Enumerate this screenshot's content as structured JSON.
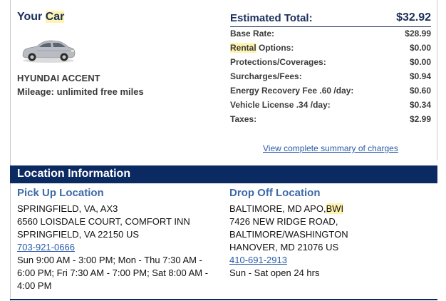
{
  "car": {
    "heading_plain": "Your ",
    "heading_highlight": "Car",
    "model": "HYUNDAI ACCENT",
    "mileage": "Mileage: unlimited free miles",
    "color": "#b9bcc2"
  },
  "estimate": {
    "title": "Estimated Total:",
    "total": "$32.92",
    "charges": [
      {
        "label": "Base Rate:",
        "amount": "$28.99"
      },
      {
        "label_highlight": "Rental",
        "label_rest": " Options:",
        "amount": "$0.00"
      },
      {
        "label": "Protections/Coverages:",
        "amount": "$0.00"
      },
      {
        "label": "Surcharges/Fees:",
        "amount": "$0.94"
      },
      {
        "label": "Energy Recovery Fee .60 /day:",
        "amount": "$0.60"
      },
      {
        "label": "Vehicle License .34 /day:",
        "amount": "$0.34"
      },
      {
        "label": "Taxes:",
        "amount": "$2.99"
      }
    ],
    "summary_link": "View complete summary of charges"
  },
  "location": {
    "section_title": "Location Information",
    "pickup": {
      "heading": "Pick Up Location",
      "line1": "SPRINGFIELD, VA, AX3",
      "line2": "6560 LOISDALE COURT, COMFORT INN",
      "line3": "SPRINGFIELD, VA 22150 US",
      "phone": "703-921-0666",
      "hours": "Sun 9:00 AM - 3:00 PM; Mon - Thu 7:30 AM - 6:00 PM; Fri 7:30 AM - 7:00 PM; Sat 8:00 AM - 4:00 PM"
    },
    "dropoff": {
      "heading": "Drop Off Location",
      "line1_plain": "BALTIMORE, MD APO,",
      "line1_highlight": "BWI",
      "line2": "7426 NEW RIDGE ROAD,",
      "line3": "BALTIMORE/WASHINGTON",
      "line4": "HANOVER, MD 21076 US",
      "phone": "410-691-2913",
      "hours": "Sun - Sat open 24 hrs"
    }
  },
  "colors": {
    "navy": "#0b2a62",
    "heading_blue": "#1b2f5c",
    "link_blue": "#2a5aa8",
    "highlight": "#fff3b0"
  }
}
